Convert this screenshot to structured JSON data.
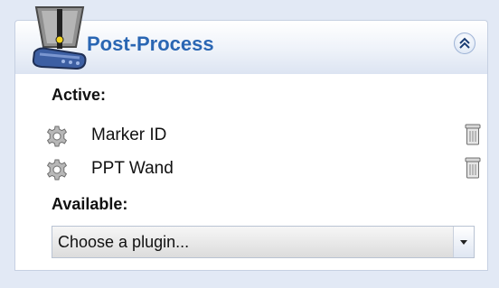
{
  "panel": {
    "title": "Post-Process",
    "active_label": "Active:",
    "available_label": "Available:",
    "active_items": [
      {
        "label": "Marker ID",
        "icon": "gear-icon",
        "action_icon": "trash-icon"
      },
      {
        "label": "PPT Wand",
        "icon": "gear-icon",
        "action_icon": "trash-icon"
      }
    ],
    "plugin_select": {
      "value": "Choose a plugin..."
    }
  },
  "colors": {
    "title": "#2a66b3",
    "header_bg": "#e2e9f5"
  }
}
